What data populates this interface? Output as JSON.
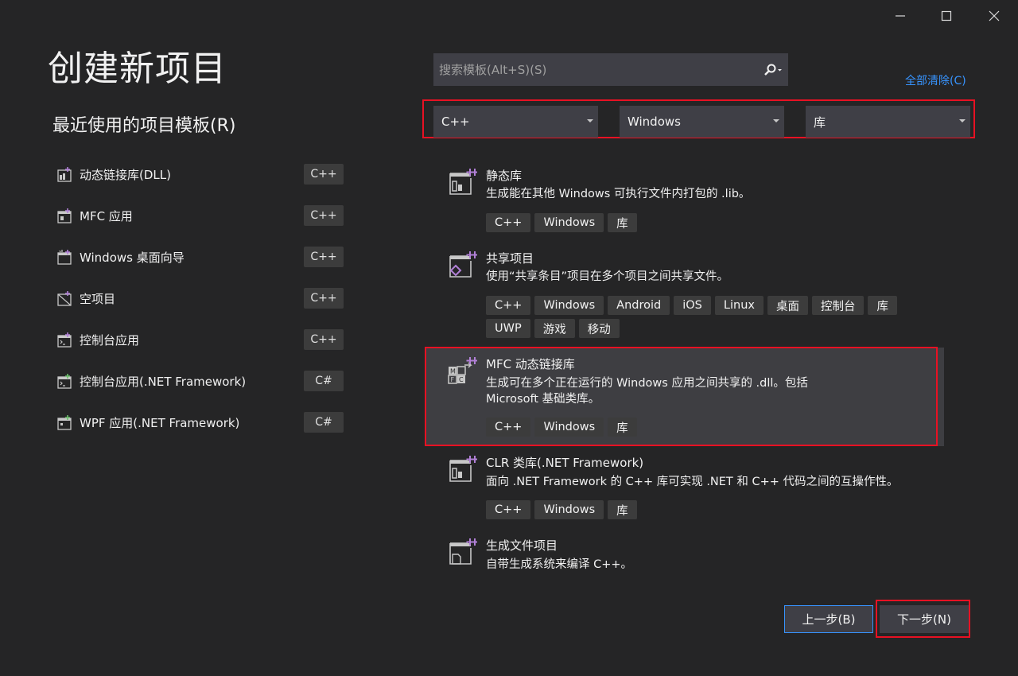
{
  "window": {
    "controls": [
      {
        "name": "minimize",
        "icon": "minimize-icon"
      },
      {
        "name": "maximize",
        "icon": "maximize-icon"
      },
      {
        "name": "close",
        "icon": "close-icon"
      }
    ]
  },
  "page": {
    "title": "创建新项目",
    "recent_title": "最近使用的项目模板(R)"
  },
  "recent": [
    {
      "label": "动态链接库(DLL)",
      "lang": "C++",
      "icon": "dll-project-icon"
    },
    {
      "label": "MFC 应用",
      "lang": "C++",
      "icon": "mfc-app-icon"
    },
    {
      "label": "Windows 桌面向导",
      "lang": "C++",
      "icon": "desktop-wizard-icon"
    },
    {
      "label": "空项目",
      "lang": "C++",
      "icon": "empty-project-icon"
    },
    {
      "label": "控制台应用",
      "lang": "C++",
      "icon": "console-app-icon"
    },
    {
      "label": "控制台应用(.NET Framework)",
      "lang": "C#",
      "icon": "console-app-icon"
    },
    {
      "label": "WPF 应用(.NET Framework)",
      "lang": "C#",
      "icon": "wpf-app-icon"
    }
  ],
  "search": {
    "placeholder": "搜索模板(Alt+S)(S)",
    "value": "",
    "icon": "search-icon"
  },
  "clear_all": "全部清除(C)",
  "filters": {
    "language": "C++",
    "platform": "Windows",
    "project_type": "库"
  },
  "templates": [
    {
      "name": "静态库",
      "description": "生成能在其他 Windows 可执行文件内打包的 .lib。",
      "tags": [
        "C++",
        "Windows",
        "库"
      ],
      "icon": "static-library-icon",
      "selected": false
    },
    {
      "name": "共享项目",
      "description": "使用“共享条目”项目在多个项目之间共享文件。",
      "tags": [
        "C++",
        "Windows",
        "Android",
        "iOS",
        "Linux",
        "桌面",
        "控制台",
        "库",
        "UWP",
        "游戏",
        "移动"
      ],
      "icon": "shared-project-icon",
      "selected": false
    },
    {
      "name": "MFC 动态链接库",
      "description": "生成可在多个正在运行的 Windows 应用之间共享的 .dll。包括 Microsoft 基础类库。",
      "tags": [
        "C++",
        "Windows",
        "库"
      ],
      "icon": "mfc-dll-icon",
      "selected": true
    },
    {
      "name": "CLR 类库(.NET Framework)",
      "description": "面向 .NET Framework 的 C++ 库可实现 .NET 和 C++ 代码之间的互操作性。",
      "tags": [
        "C++",
        "Windows",
        "库"
      ],
      "icon": "clr-library-icon",
      "selected": false
    },
    {
      "name": "生成文件项目",
      "description": "自带生成系统来编译 C++。",
      "tags": [],
      "icon": "makefile-project-icon",
      "selected": false
    }
  ],
  "buttons": {
    "back": "上一步(B)",
    "next": "下一步(N)"
  },
  "colors": {
    "background": "#252526",
    "accent": "#3794ff",
    "highlight_frame": "#e81123",
    "project_icon_plus": "#b180d7"
  }
}
